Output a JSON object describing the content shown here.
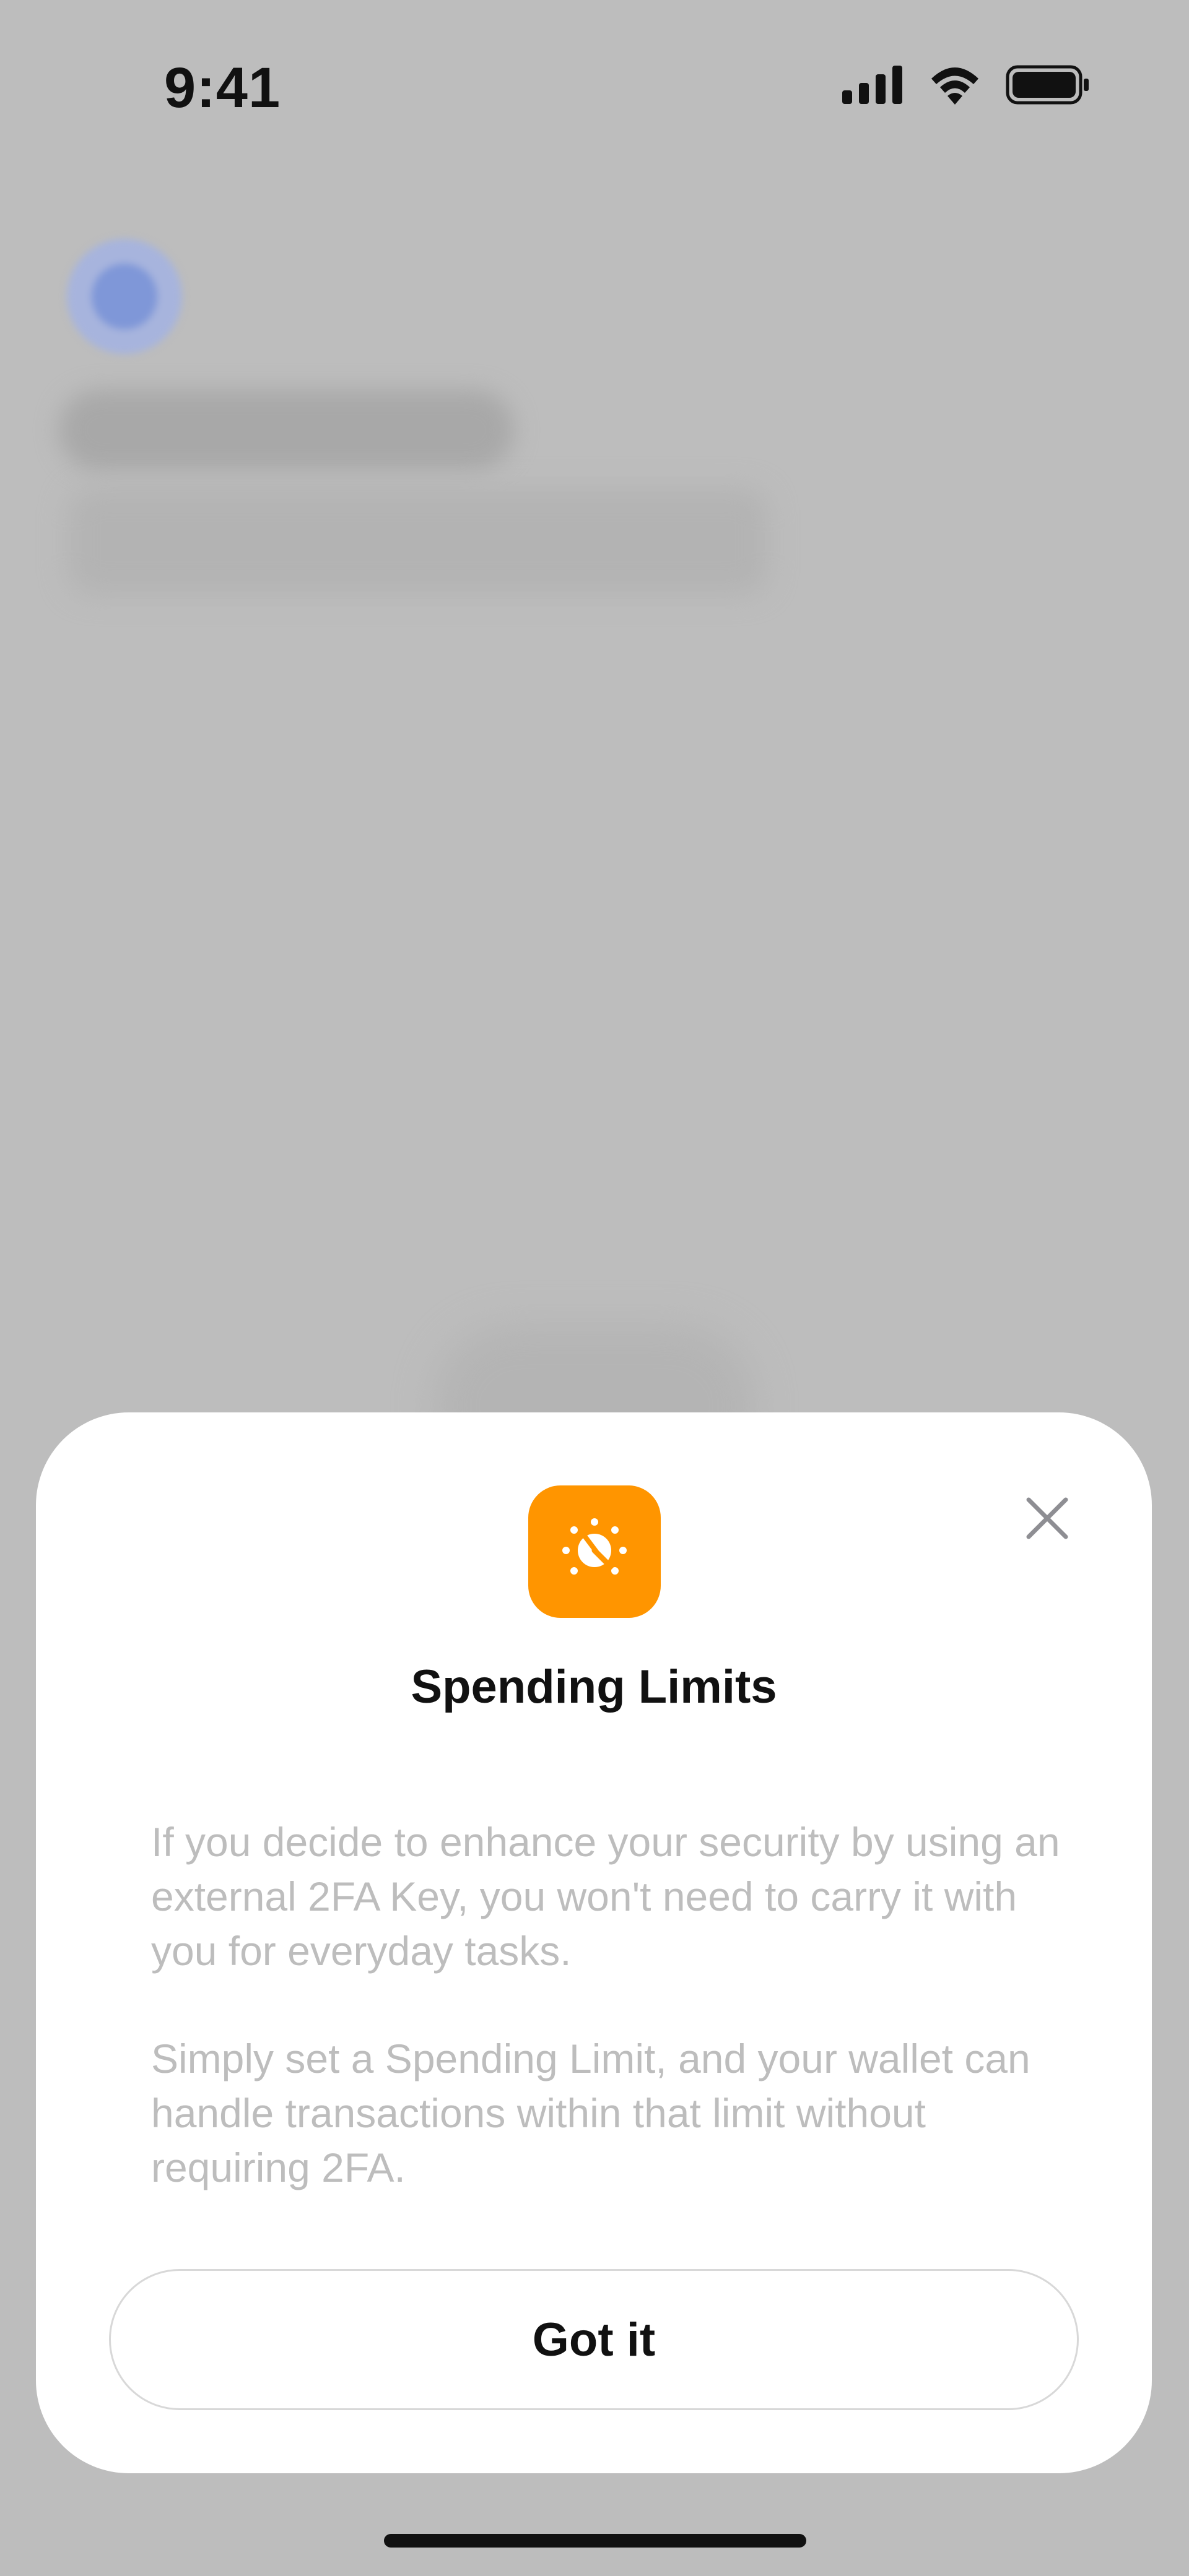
{
  "status_bar": {
    "time": "9:41"
  },
  "sheet": {
    "icon": "speedometer-gauge-icon",
    "accent_color": "#ff9500",
    "title": "Spending Limits",
    "paragraphs": [
      "If you decide to enhance your security by using an external 2FA Key, you won't need to carry it with you for everyday tasks.",
      "Simply set a Spending Limit, and your wallet can handle transactions within that limit without requiring 2FA."
    ],
    "primary_button_label": "Got it",
    "close_icon": "close-icon"
  }
}
